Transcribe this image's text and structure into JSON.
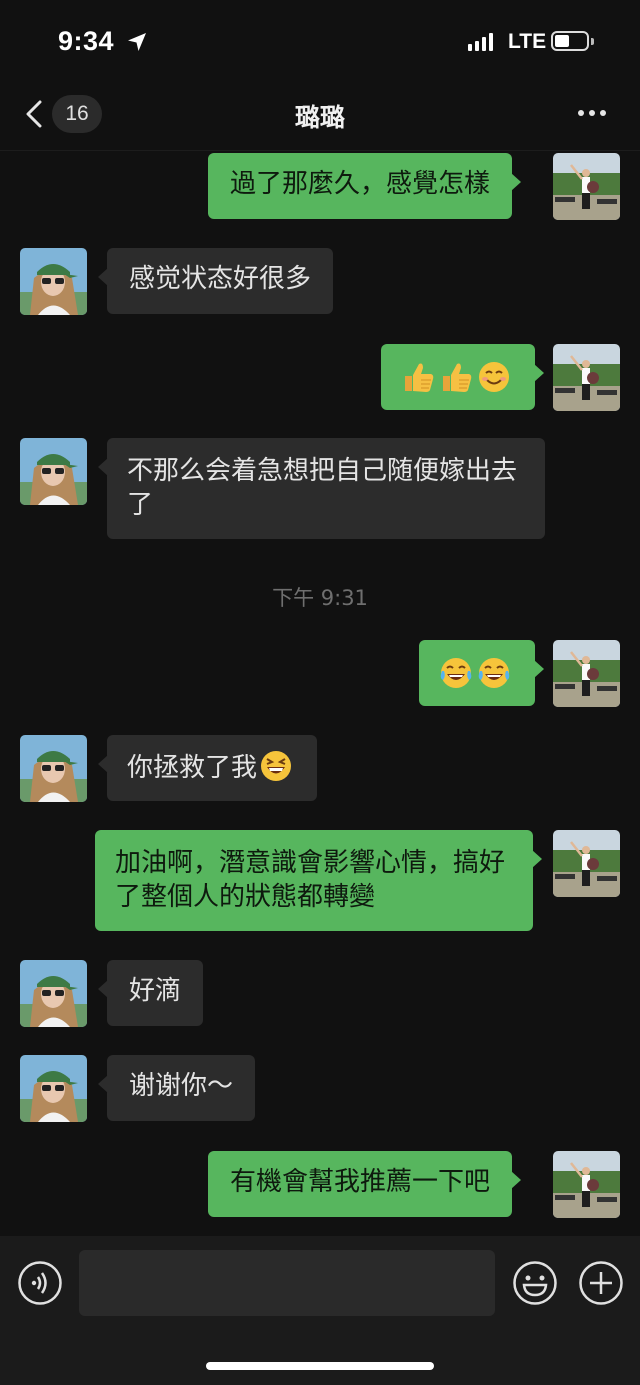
{
  "status_bar": {
    "time": "9:34",
    "network": "LTE"
  },
  "nav": {
    "unread_count": "16",
    "title": "璐璐"
  },
  "messages": [
    {
      "from": "me",
      "text": "過了那麼久，感覺怎樣"
    },
    {
      "from": "other",
      "text": "感觉状态好很多"
    },
    {
      "from": "me",
      "text": "",
      "emojis": [
        "thumbs-up",
        "thumbs-up",
        "smiling-face"
      ]
    },
    {
      "from": "other",
      "text": "不那么会着急想把自己随便嫁出去了"
    },
    {
      "from": "me",
      "text": "",
      "emojis": [
        "tears-of-joy",
        "tears-of-joy"
      ]
    },
    {
      "from": "other",
      "text": "你拯救了我",
      "emojis": [
        "grinning-squint"
      ]
    },
    {
      "from": "me",
      "text": "加油啊，潛意識會影響心情，搞好了整個人的狀態都轉變"
    },
    {
      "from": "other",
      "text": "好滴"
    },
    {
      "from": "other",
      "text": "谢谢你～"
    },
    {
      "from": "me",
      "text": "有機會幫我推薦一下吧"
    }
  ],
  "timestamp": "下午 9:31",
  "colors": {
    "my_bubble": "#57b65e",
    "other_bubble": "#2c2c2c",
    "background": "#111111"
  }
}
